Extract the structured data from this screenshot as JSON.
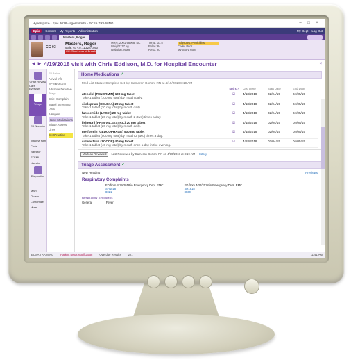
{
  "window": {
    "title": "Hyperspace - Epic 2018 - agent-smith - ECSA TRAINING"
  },
  "menubar": {
    "epic": "Epic",
    "items": [
      "Content",
      "My Reports",
      "Administration"
    ],
    "right": [
      "My Dept",
      "Log Out"
    ]
  },
  "patient": {
    "cc": "CC 03",
    "name": "Masters, Roger",
    "dob": "Male, 67 y.o., 10/27/1950",
    "alert": "CC: Shortness of Breath",
    "tab_label": "Masters, Roger",
    "mrn": "MRN: 2001-58968, ML",
    "weight": "Weight: 77 kg",
    "isolation": "Isolation: None",
    "temp": "Temp: 37.5",
    "pulse": "Pulse: 84",
    "resp": "Resp: 20",
    "allergy": "Allergies: Penicillins",
    "code": "Code: Prior",
    "story": "My Story Note"
  },
  "visit_title": "4/19/2018 visit with Chris Eddison, M.D. for Hospital Encounter",
  "leftnav": [
    {
      "label": "Chart Review",
      "icon": "chart-review-icon"
    },
    {
      "label": "Triage",
      "icon": "triage-icon"
    },
    {
      "label": "ED Narrator",
      "icon": "ed-narrator-icon"
    },
    {
      "label": "Disposition",
      "icon": "disposition-icon"
    }
  ],
  "leftnav_text": [
    "Chart Review",
    "Care Everywh",
    "Triage",
    "ED Narrator",
    "Trauma Narr",
    "Code Narrator",
    "STEMI Narrator",
    "Disposition",
    "MAR",
    "Orders",
    "Customize",
    "More"
  ],
  "subnav": {
    "group1": "ED Arrival",
    "items1": [
      "Arrival Info",
      "PCP/Referral",
      "Advance Directive"
    ],
    "group2": "Triage",
    "items2": [
      "Chief Complaint",
      "Travel Screening",
      "Vitals",
      "Allergies",
      "Home Medications",
      "Triage Assess",
      "Lines"
    ],
    "highlight": "BestPractice"
  },
  "home_meds": {
    "title": "Home Medications",
    "status": "Med List Status: Complete Set by: Cameron Gorton, RN at 4/19/2018 8:19 AM",
    "headers": [
      "",
      "Taking?",
      "Last Dose",
      "Start Date",
      "End Date"
    ],
    "rows": [
      {
        "name": "atenolol (TENORMIN) 100 mg tablet",
        "sig": "Take 1 tablet (100 mg total) by mouth daily.",
        "last": "4/18/2018",
        "start": "02/04/15",
        "end": "04/05/15"
      },
      {
        "name": "citalopram (CELEXA) 20 mg tablet",
        "sig": "Take 1 tablet (20 mg total) by mouth daily.",
        "last": "4/18/2018",
        "start": "02/04/15",
        "end": "04/05/15"
      },
      {
        "name": "furosemide (LASIX) 20 mg tablet",
        "sig": "Take 1 tablet (20 mg total) by mouth 2 (two) times a day.",
        "last": "4/18/2018",
        "start": "02/04/15",
        "end": "04/05/15"
      },
      {
        "name": "lisinopril (PRINIVIL,ZESTRIL) 20 mg tablet",
        "sig": "Take 1 tablet (20 mg total) by mouth daily.",
        "last": "4/18/2018",
        "start": "02/04/15",
        "end": "04/05/15"
      },
      {
        "name": "metformin (GLUCOPHAGE) 500 mg tablet",
        "sig": "Take 1 tablet (500 mg total) by mouth 2 (two) times a day.",
        "last": "4/18/2018",
        "start": "02/04/15",
        "end": "04/05/15"
      },
      {
        "name": "simvastatin (ZOCOR) 40 mg tablet",
        "sig": "Take 1 tablet (40 mg total) by mouth once a day in the evening.",
        "last": "4/18/2018",
        "start": "02/04/15",
        "end": "04/05/15"
      }
    ],
    "mark_reviewed": "Mark as Reviewed",
    "last_reviewed": "Last Reviewed by Cameron Gorton, RN on 4/19/2018 at 8:19 AM",
    "history": "History"
  },
  "triage": {
    "title": "Triage Assessment",
    "new_heading": "New Heading",
    "previews": "Previews",
    "rc_title": "Respiratory Complaints",
    "ed_left": "ED from 4/19/2018 in Emergency Dept. EMC",
    "ed_left_link": "SH1818",
    "ed_left_code": "8021",
    "ed_right": "ED from 4/30/2018 in Emergency Dept. EMC",
    "ed_right_link": "SH1818",
    "ed_right_code": "8030",
    "symptoms": "Respiratory Symptoms",
    "general": "General",
    "general_val": "Fever"
  },
  "statusbar": {
    "left": "ECSA TRAINING",
    "notif": "Patient Msgs Notification",
    "overdue": "Overdue Results",
    "count": "221",
    "time": "11:41 AM"
  },
  "colors": {
    "accent": "#6b3fa0",
    "menubar": "#3b3b7a",
    "toolbar": "#5b3d91",
    "epic": "#b0124a"
  }
}
